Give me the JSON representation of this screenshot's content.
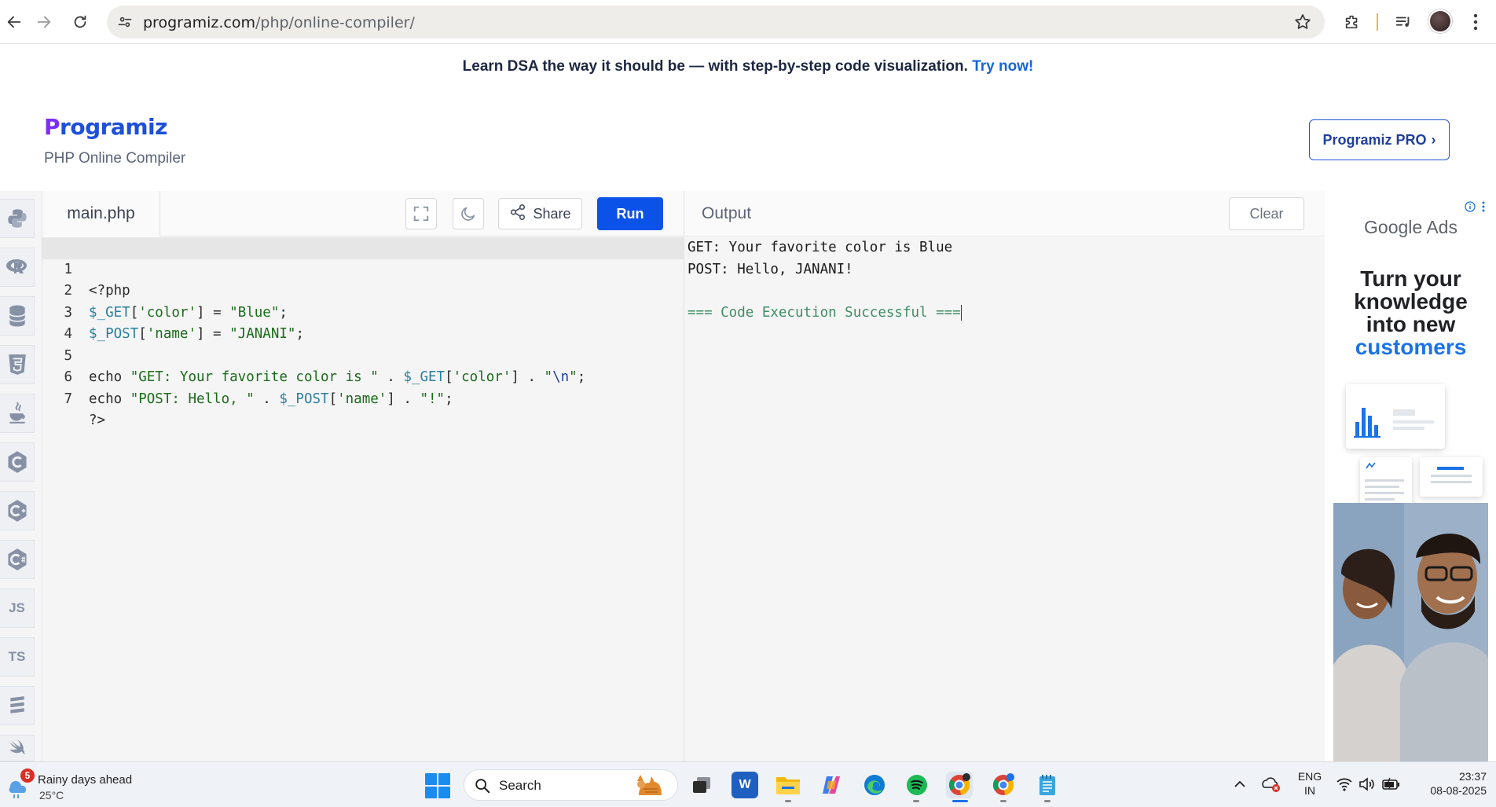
{
  "browser": {
    "url_host": "programiz.com",
    "url_path": "/php/online-compiler/"
  },
  "banner": {
    "text": "Learn DSA the way it should be — with step-by-step code visualization.",
    "link": "Try now!"
  },
  "header": {
    "logo_first": "P",
    "logo_rest": "rogramiz",
    "subtitle": "PHP Online Compiler",
    "pro_button": "Programiz PRO",
    "pro_chevron": "›"
  },
  "rail": {
    "items": [
      {
        "name": "python",
        "label": ""
      },
      {
        "name": "r",
        "label": ""
      },
      {
        "name": "sql",
        "label": ""
      },
      {
        "name": "html",
        "label": ""
      },
      {
        "name": "java",
        "label": ""
      },
      {
        "name": "c",
        "label": ""
      },
      {
        "name": "cpp",
        "label": ""
      },
      {
        "name": "csharp",
        "label": ""
      },
      {
        "name": "js",
        "label": "JS"
      },
      {
        "name": "ts",
        "label": "TS"
      },
      {
        "name": "go",
        "label": ""
      },
      {
        "name": "swift",
        "label": ""
      }
    ]
  },
  "editor": {
    "file_tab": "main.php",
    "share_label": "Share",
    "run_label": "Run",
    "lines": [
      {
        "n": "1",
        "code": "<?php"
      },
      {
        "n": "2",
        "code": "$_GET['color'] = \"Blue\";"
      },
      {
        "n": "3",
        "code": "$_POST['name'] = \"JANANI\";"
      },
      {
        "n": "4",
        "code": ""
      },
      {
        "n": "5",
        "code": "echo \"GET: Your favorite color is \" . $_GET['color'] . \"\\n\";"
      },
      {
        "n": "6",
        "code": "echo \"POST: Hello, \" . $_POST['name'] . \"!\";"
      },
      {
        "n": "7",
        "code": "?>"
      }
    ]
  },
  "output": {
    "title": "Output",
    "clear_label": "Clear",
    "lines": [
      "GET: Your favorite color is Blue",
      "POST: Hello, JANANI!",
      "",
      "=== Code Execution Successful ==="
    ]
  },
  "ad": {
    "logo": "Google Ads",
    "headline_line1": "Turn your",
    "headline_line2": "knowledge",
    "headline_line3": "into new",
    "headline_line4": "customers"
  },
  "taskbar": {
    "weather_badge": "5",
    "weather_title": "Rainy days ahead",
    "weather_temp": "25°C",
    "search_label": "Search",
    "lang_line1": "ENG",
    "lang_line2": "IN",
    "time": "23:37",
    "date": "08-08-2025"
  },
  "colors": {
    "run_button": "#0b53e8",
    "brand_blue": "#1e4fd8",
    "success_text": "#3f8c66"
  }
}
